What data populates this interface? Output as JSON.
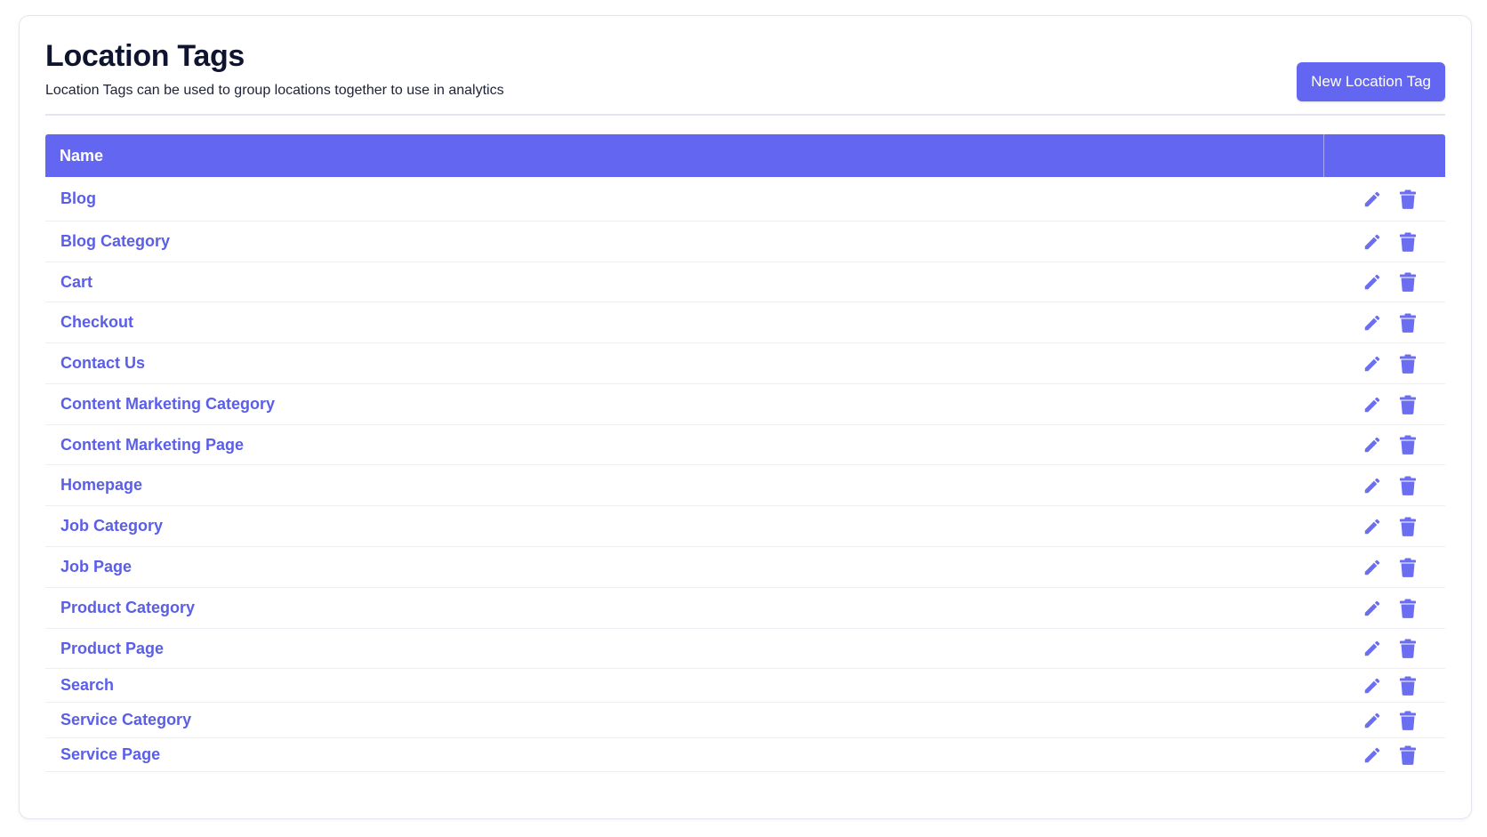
{
  "header": {
    "title": "Location Tags",
    "subtitle": "Location Tags can be used to group locations together to use in analytics",
    "new_button_label": "New Location Tag"
  },
  "table": {
    "columns": [
      "Name",
      ""
    ],
    "rows": [
      "Blog",
      "Blog Category",
      "Cart",
      "Checkout",
      "Contact Us",
      "Content Marketing Category",
      "Content Marketing Page",
      "Homepage",
      "Job Category",
      "Job Page",
      "Product Category",
      "Product Page",
      "Search",
      "Service Category",
      "Service Page"
    ],
    "row_actions": [
      "pencil-icon",
      "trash-icon"
    ]
  },
  "colors": {
    "accent": "#6366f1",
    "link": "#5a5ee8",
    "icon": "#6b6ef0"
  }
}
